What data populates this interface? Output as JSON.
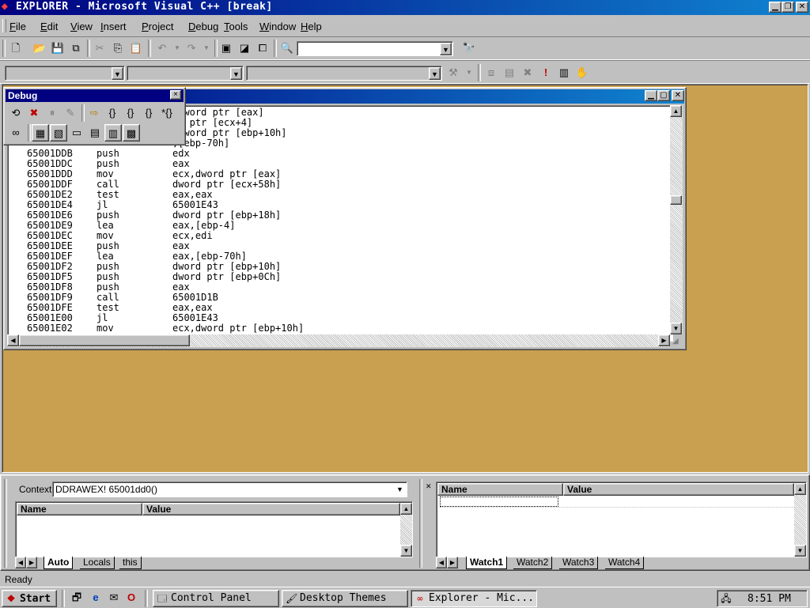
{
  "window": {
    "title": "EXPLORER - Microsoft Visual C++ [break]"
  },
  "menu": [
    {
      "pre": "",
      "u": "F",
      "post": "ile"
    },
    {
      "pre": "",
      "u": "E",
      "post": "dit"
    },
    {
      "pre": "",
      "u": "V",
      "post": "iew"
    },
    {
      "pre": "",
      "u": "I",
      "post": "nsert"
    },
    {
      "pre": "",
      "u": "P",
      "post": "roject"
    },
    {
      "pre": "",
      "u": "D",
      "post": "ebug"
    },
    {
      "pre": "",
      "u": "T",
      "post": "ools"
    },
    {
      "pre": "",
      "u": "W",
      "post": "indow"
    },
    {
      "pre": "",
      "u": "H",
      "post": "elp"
    }
  ],
  "debug_toolbar": {
    "title": "Debug",
    "close": "×"
  },
  "disasm": {
    "partial": [
      {
        "op": ",dword ptr [eax]"
      },
      {
        "op": "rd ptr [ecx+4]"
      },
      {
        "op": ",dword ptr [ebp+10h]"
      },
      {
        "op": ",[ebp-70h]"
      }
    ],
    "lines": [
      {
        "addr": "65001DDB",
        "mn": "push",
        "op": "edx"
      },
      {
        "addr": "65001DDC",
        "mn": "push",
        "op": "eax"
      },
      {
        "addr": "65001DDD",
        "mn": "mov",
        "op": "ecx,dword ptr [eax]"
      },
      {
        "addr": "65001DDF",
        "mn": "call",
        "op": "dword ptr [ecx+58h]"
      },
      {
        "addr": "65001DE2",
        "mn": "test",
        "op": "eax,eax"
      },
      {
        "addr": "65001DE4",
        "mn": "jl",
        "op": "65001E43"
      },
      {
        "addr": "65001DE6",
        "mn": "push",
        "op": "dword ptr [ebp+18h]"
      },
      {
        "addr": "65001DE9",
        "mn": "lea",
        "op": "eax,[ebp-4]"
      },
      {
        "addr": "65001DEC",
        "mn": "mov",
        "op": "ecx,edi"
      },
      {
        "addr": "65001DEE",
        "mn": "push",
        "op": "eax"
      },
      {
        "addr": "65001DEF",
        "mn": "lea",
        "op": "eax,[ebp-70h]"
      },
      {
        "addr": "65001DF2",
        "mn": "push",
        "op": "dword ptr [ebp+10h]"
      },
      {
        "addr": "65001DF5",
        "mn": "push",
        "op": "dword ptr [ebp+0Ch]"
      },
      {
        "addr": "65001DF8",
        "mn": "push",
        "op": "eax"
      },
      {
        "addr": "65001DF9",
        "mn": "call",
        "op": "65001D1B"
      },
      {
        "addr": "65001DFE",
        "mn": "test",
        "op": "eax,eax"
      },
      {
        "addr": "65001E00",
        "mn": "jl",
        "op": "65001E43"
      },
      {
        "addr": "65001E02",
        "mn": "mov",
        "op": "ecx,dword ptr [ebp+10h]"
      }
    ]
  },
  "variables": {
    "context_label": "Context:",
    "context_value": "DDRAWEX! 65001dd0()",
    "col_name": "Name",
    "col_value": "Value",
    "tabs": [
      "Auto",
      "Locals",
      "this"
    ]
  },
  "watch": {
    "col_name": "Name",
    "col_value": "Value",
    "tabs": [
      "Watch1",
      "Watch2",
      "Watch3",
      "Watch4"
    ]
  },
  "status": {
    "text": "Ready"
  },
  "taskbar": {
    "start": "Start",
    "tasks": [
      "Control Panel",
      "Desktop Themes",
      "Explorer - Mic..."
    ],
    "clock": "8:51 PM"
  },
  "colors": {
    "titlebar": "#000080",
    "workspace": "#c8a050",
    "face": "#c0c0c0"
  }
}
